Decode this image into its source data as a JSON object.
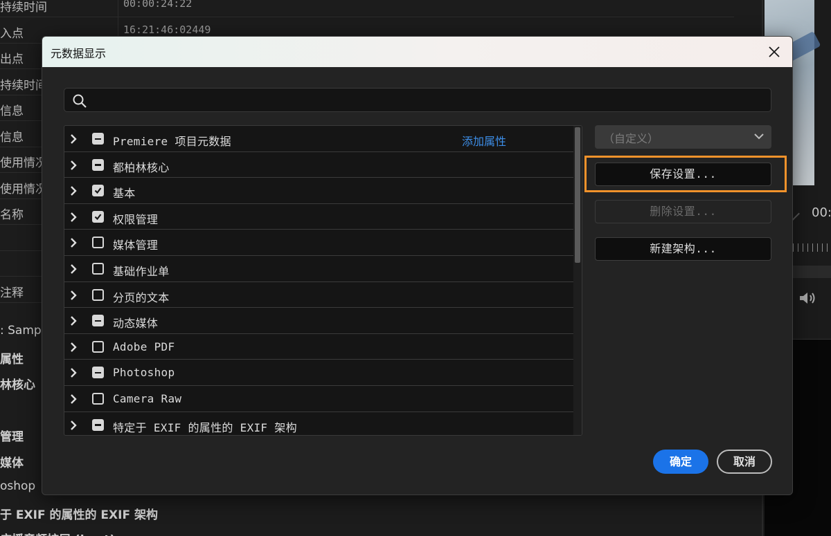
{
  "background": {
    "rows": [
      {
        "label": "持续时间",
        "value": "00:00:24:22"
      },
      {
        "label": "入点",
        "value": "16:21:46:02449"
      },
      {
        "label": "出点",
        "value": ""
      },
      {
        "label": "持续时间",
        "value": ""
      },
      {
        "label": "信息",
        "value": ""
      },
      {
        "label": "信息",
        "value": ""
      },
      {
        "label": "使用情况",
        "value": ""
      },
      {
        "label": "使用情况",
        "value": ""
      },
      {
        "label": "名称",
        "value": ""
      },
      {
        "label": "",
        "value": ""
      },
      {
        "label": "",
        "value": ""
      },
      {
        "label": "注释",
        "value": ""
      }
    ],
    "sections": [
      ": Sample",
      "属性",
      "林核心",
      "",
      "管理",
      "媒体",
      "oshop",
      "于 EXIF 的属性的 EXIF 架构",
      "广播音频扩展 (bext)"
    ],
    "right_timecode": "00:"
  },
  "dialog": {
    "title": "元数据显示",
    "search": {
      "value": "",
      "placeholder": ""
    },
    "add_property": "添加属性",
    "rows": [
      {
        "label": "Premiere 项目元数据",
        "state": "mixed"
      },
      {
        "label": "都柏林核心",
        "state": "mixed"
      },
      {
        "label": "基本",
        "state": "checked"
      },
      {
        "label": "权限管理",
        "state": "checked"
      },
      {
        "label": "媒体管理",
        "state": "unchecked"
      },
      {
        "label": "基础作业单",
        "state": "unchecked"
      },
      {
        "label": "分页的文本",
        "state": "unchecked"
      },
      {
        "label": "动态媒体",
        "state": "mixed"
      },
      {
        "label": "Adobe PDF",
        "state": "unchecked"
      },
      {
        "label": "Photoshop",
        "state": "mixed"
      },
      {
        "label": "Camera Raw",
        "state": "unchecked"
      },
      {
        "label": "特定于 EXIF 的属性的 EXIF 架构",
        "state": "mixed"
      }
    ],
    "preset_select": "（自定义）",
    "save_settings": "保存设置...",
    "delete_settings": "删除设置...",
    "new_schema": "新建架构...",
    "ok": "确定",
    "cancel": "取消"
  },
  "colors": {
    "accent": "#1b73e8",
    "link": "#3d8ee8",
    "highlight": "#f1922b"
  }
}
